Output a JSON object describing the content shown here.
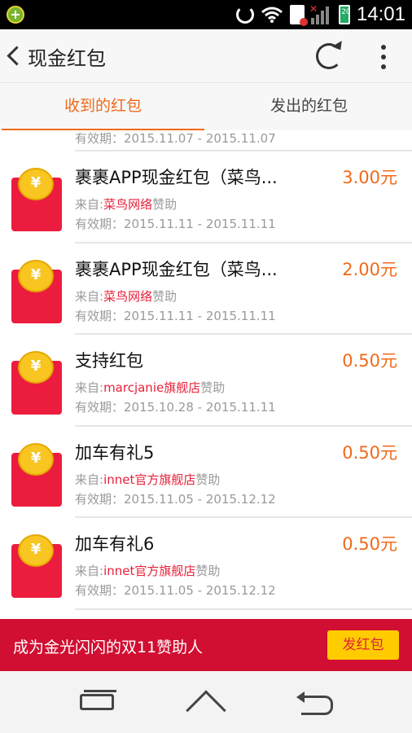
{
  "status_bar": {
    "time": "14:01",
    "battery_label": "20",
    "icons": [
      "app-notification-icon",
      "sync-icon",
      "wifi-icon",
      "sim-icon",
      "signal-icon",
      "battery-icon"
    ]
  },
  "header": {
    "title": "现金红包",
    "back_icon": "back-arrow-icon",
    "refresh_icon": "refresh-icon",
    "more_icon": "more-vertical-icon"
  },
  "tabs": [
    {
      "label": "收到的红包",
      "active": true
    },
    {
      "label": "发出的红包",
      "active": false
    }
  ],
  "list": {
    "partial_item": {
      "validity": "有效期：2015.11.07 - 2015.11.07"
    },
    "items": [
      {
        "title": "裹裹APP现金红包（菜鸟...",
        "amount": "3.00元",
        "source_prefix": "来自:",
        "source_shop": "菜鸟网络",
        "source_suffix": "赞助",
        "validity": "有效期：2015.11.11 - 2015.11.11"
      },
      {
        "title": "裹裹APP现金红包（菜鸟...",
        "amount": "2.00元",
        "source_prefix": "来自:",
        "source_shop": "菜鸟网络",
        "source_suffix": "赞助",
        "validity": "有效期：2015.11.11 - 2015.11.11"
      },
      {
        "title": "支持红包",
        "amount": "0.50元",
        "source_prefix": "来自:",
        "source_shop": "marcjanie旗舰店",
        "source_suffix": "赞助",
        "validity": "有效期：2015.10.28 - 2015.11.11"
      },
      {
        "title": "加车有礼5",
        "amount": "0.50元",
        "source_prefix": "来自:",
        "source_shop": "innet官方旗舰店",
        "source_suffix": "赞助",
        "validity": "有效期：2015.11.05 - 2015.12.12"
      },
      {
        "title": "加车有礼6",
        "amount": "0.50元",
        "source_prefix": "来自:",
        "source_shop": "innet官方旗舰店",
        "source_suffix": "赞助",
        "validity": "有效期：2015.11.05 - 2015.12.12"
      }
    ],
    "coin_symbol": "¥"
  },
  "banner": {
    "text": "成为金光闪闪的双11赞助人",
    "button_label": "发红包"
  },
  "navbar": {
    "icons": [
      "recent-apps-icon",
      "home-icon",
      "back-icon"
    ]
  },
  "colors": {
    "accent": "#f06a1a",
    "envelope": "#ec1c3e",
    "banner": "#d10f32",
    "button": "#ffcc00"
  }
}
